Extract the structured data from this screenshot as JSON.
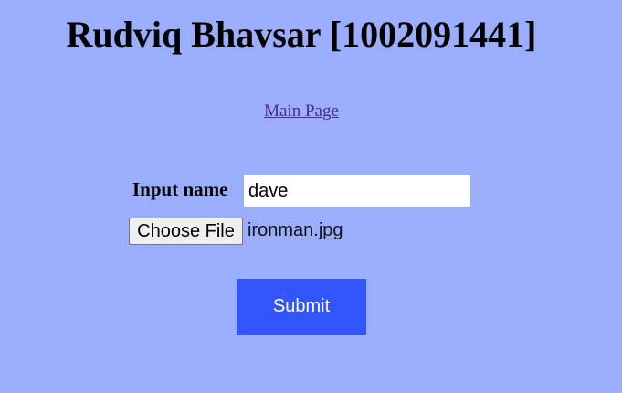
{
  "header": {
    "title": "Rudviq Bhavsar [1002091441]"
  },
  "nav": {
    "main_page_link": "Main Page"
  },
  "form": {
    "name_label": "Input name",
    "name_value": "dave",
    "choose_file_label": "Choose File",
    "file_name": "ironman.jpg",
    "submit_label": "Submit"
  }
}
